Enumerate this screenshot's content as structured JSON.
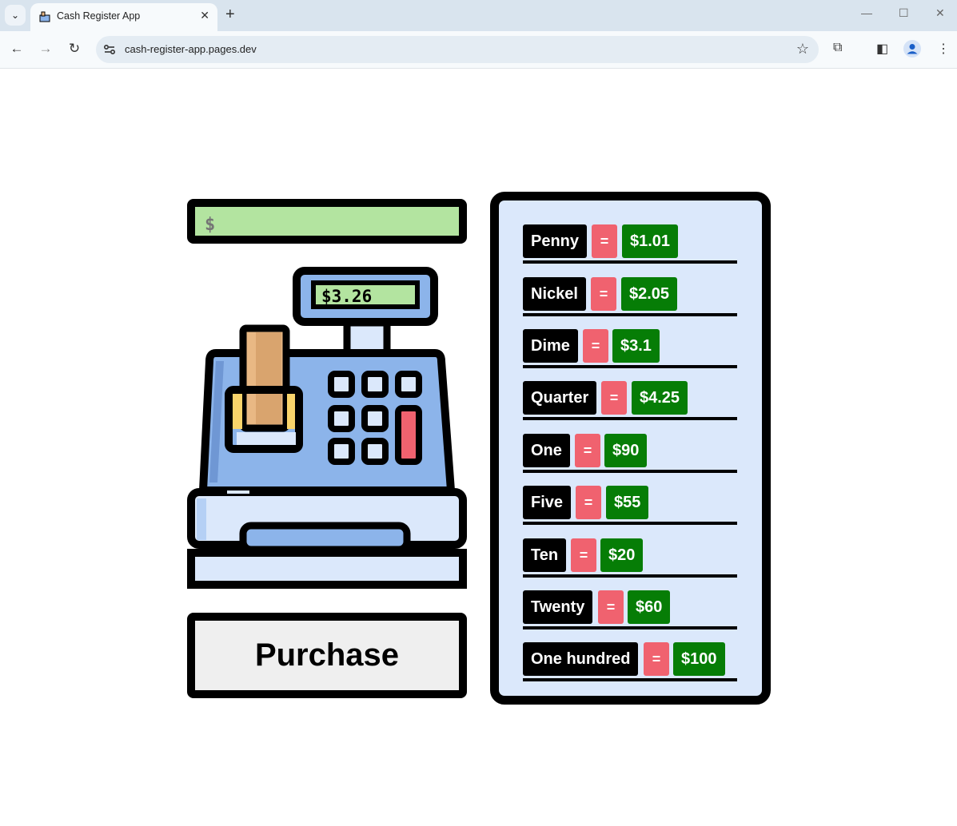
{
  "browser": {
    "tab_title": "Cash Register App",
    "url": "cash-register-app.pages.dev"
  },
  "display": {
    "prefix": "$",
    "value": ""
  },
  "register": {
    "screen_text": "$3.26"
  },
  "purchase_label": "Purchase",
  "drawer": {
    "rows": [
      {
        "name": "Penny",
        "eq": "=",
        "amount": "$1.01"
      },
      {
        "name": "Nickel",
        "eq": "=",
        "amount": "$2.05"
      },
      {
        "name": "Dime",
        "eq": "=",
        "amount": "$3.1"
      },
      {
        "name": "Quarter",
        "eq": "=",
        "amount": "$4.25"
      },
      {
        "name": "One",
        "eq": "=",
        "amount": "$90"
      },
      {
        "name": "Five",
        "eq": "=",
        "amount": "$55"
      },
      {
        "name": "Ten",
        "eq": "=",
        "amount": "$20"
      },
      {
        "name": "Twenty",
        "eq": "=",
        "amount": "$60"
      },
      {
        "name": "One hundred",
        "eq": "=",
        "amount": "$100"
      }
    ]
  },
  "colors": {
    "display_green": "#b3e4a0",
    "drawer_bg": "#dbe8fb",
    "equals_red": "#f0626f",
    "amount_green": "#067d06",
    "register_blue": "#8cb4ea",
    "register_light": "#dbe8fb",
    "receipt": "#e9b884"
  }
}
